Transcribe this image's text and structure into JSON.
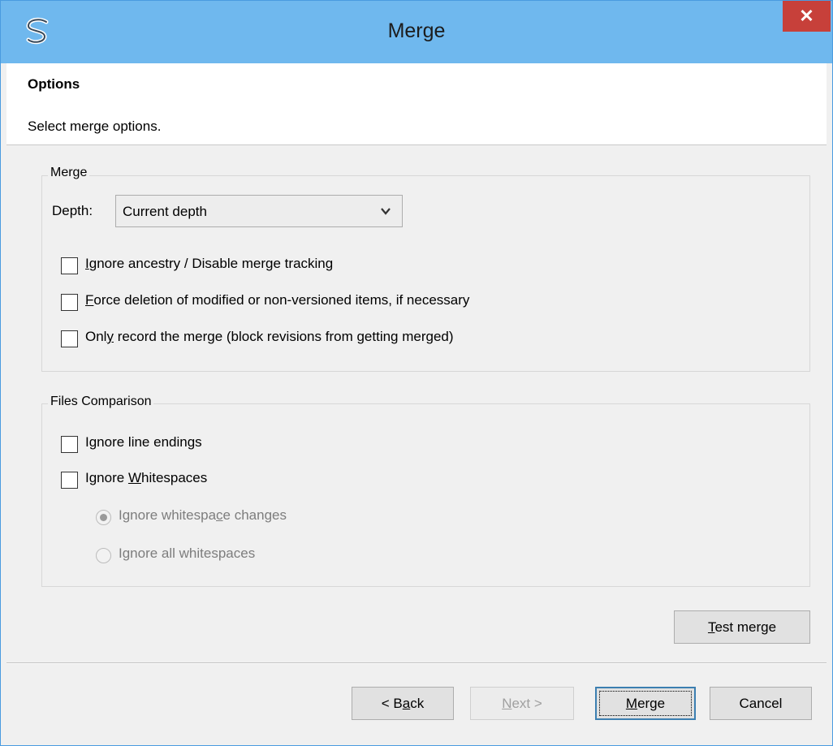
{
  "window": {
    "title": "Merge",
    "close_glyph": "✕",
    "app_icon": "tortoise-svn-icon"
  },
  "header": {
    "title": "Options",
    "subtitle": "Select merge options."
  },
  "merge_group": {
    "legend": "Merge",
    "depth_label": "Depth:",
    "depth_value": "Current depth",
    "checkboxes": [
      {
        "pre": "",
        "ul": "I",
        "post": "gnore ancestry / Disable merge tracking",
        "checked": false
      },
      {
        "pre": "",
        "ul": "F",
        "post": "orce deletion of modified or non-versioned items, if necessary",
        "checked": false
      },
      {
        "pre": "Onl",
        "ul": "y",
        "post": " record the merge (block revisions from getting merged)",
        "checked": false
      }
    ]
  },
  "files_group": {
    "legend": "Files Comparison",
    "checkboxes": [
      {
        "pre": "",
        "ul": "",
        "post": "Ignore line endings",
        "checked": false
      },
      {
        "pre": "Ignore ",
        "ul": "W",
        "post": "hitespaces",
        "checked": false
      }
    ],
    "radios": [
      {
        "pre": "Ignore whitespa",
        "ul": "c",
        "post": "e changes",
        "selected": true,
        "enabled": false
      },
      {
        "pre": "Ignore all whitespaces",
        "ul": "",
        "post": "",
        "selected": false,
        "enabled": false
      }
    ]
  },
  "buttons": {
    "test_merge": {
      "pre": "",
      "ul": "T",
      "post": "est merge"
    },
    "back": {
      "pre": "< B",
      "ul": "a",
      "post": "ck"
    },
    "next": {
      "pre": "",
      "ul": "N",
      "post": "ext >",
      "enabled": false
    },
    "merge": {
      "pre": "",
      "ul": "M",
      "post": "erge",
      "default": true
    },
    "cancel": {
      "pre": "Cancel",
      "ul": "",
      "post": ""
    }
  },
  "colors": {
    "titlebar": "#6fb8ee",
    "close": "#c7403a",
    "dialog_bg": "#f0f0f0",
    "accent_border": "#3c7fb1"
  }
}
